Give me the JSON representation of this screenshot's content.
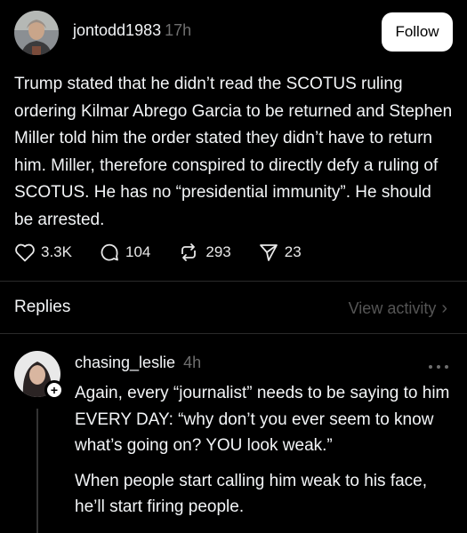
{
  "post": {
    "username": "jontodd1983",
    "time": "17h",
    "follow_label": "Follow",
    "text": "Trump stated that he didn’t read the SCOTUS ruling ordering Kilmar Abrego Garcia to be returned and Stephen Miller told him the order stated they didn’t have to return him.  Miller, therefore conspired to directly defy a ruling of SCOTUS.  He has no “presidential immunity”. He should be arrested.",
    "likes": "3.3K",
    "comments": "104",
    "reposts": "293",
    "shares": "23"
  },
  "replies_section": {
    "label": "Replies",
    "view_activity": "View activity"
  },
  "reply": {
    "username": "chasing_leslie",
    "time": "4h",
    "paragraph1": "Again, every “journalist” needs to be saying to him EVERY DAY: “why don’t you ever seem to know what’s going on?  YOU look weak.”",
    "paragraph2": "When people start calling him weak to his face, he’ll start firing people."
  },
  "icons": {
    "like": "heart-icon",
    "comment": "comment-icon",
    "repost": "repost-icon",
    "share": "send-icon",
    "more": "more-icon",
    "chevron": "chevron-right-icon",
    "follow_badge": "plus-icon"
  },
  "colors": {
    "background": "#000000",
    "text": "#f3f5f7",
    "muted": "#6e6e6e",
    "follow_bg": "#ffffff"
  }
}
